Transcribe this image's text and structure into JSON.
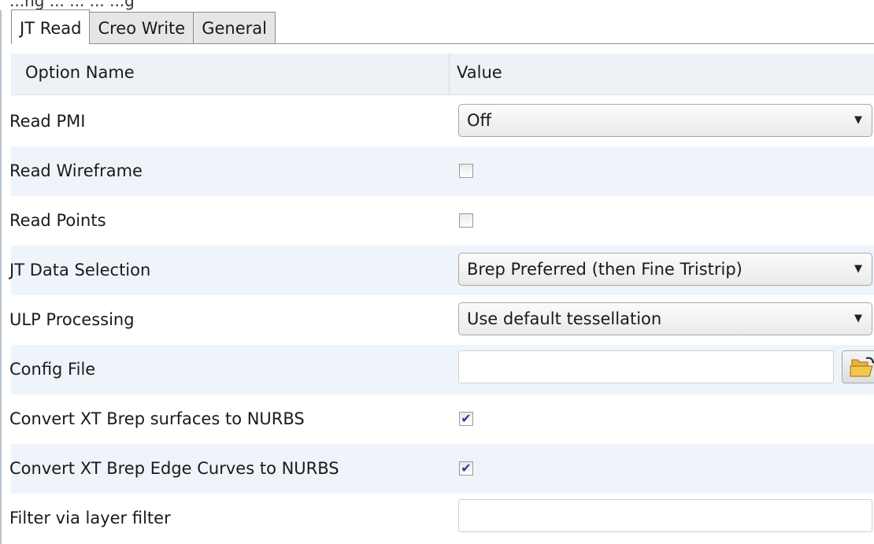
{
  "top_strip": {
    "clipped_text": "...ng ... ... ... ...g"
  },
  "tabs": [
    {
      "label": "JT Read",
      "active": true
    },
    {
      "label": "Creo Write",
      "active": false
    },
    {
      "label": "General",
      "active": false
    }
  ],
  "columns": {
    "option_name": "Option Name",
    "value": "Value"
  },
  "rows": {
    "read_pmi": {
      "label": "Read PMI",
      "value": "Off"
    },
    "read_wireframe": {
      "label": "Read Wireframe",
      "checked": false
    },
    "read_points": {
      "label": "Read Points",
      "checked": false
    },
    "jt_data_selection": {
      "label": "JT Data Selection",
      "value": "Brep Preferred (then Fine Tristrip)"
    },
    "ulp_processing": {
      "label": "ULP Processing",
      "value": "Use default tessellation"
    },
    "config_file": {
      "label": "Config File",
      "value": ""
    },
    "convert_surfaces": {
      "label": "Convert XT Brep surfaces to NURBS",
      "checked": true
    },
    "convert_edges": {
      "label": "Convert XT Brep Edge Curves to NURBS",
      "checked": true
    },
    "filter_layer": {
      "label": "Filter via layer filter",
      "value": ""
    }
  },
  "glyphs": {
    "dropdown_arrow": "▼",
    "check_mark": "✔"
  },
  "colors": {
    "accent_check": "#2a3a9a",
    "row_alt": "#eef4fa",
    "header_bg": "#eef1f5"
  },
  "icons": [
    "folder-open-icon",
    "dropdown-arrow-icon",
    "check-mark-icon"
  ]
}
